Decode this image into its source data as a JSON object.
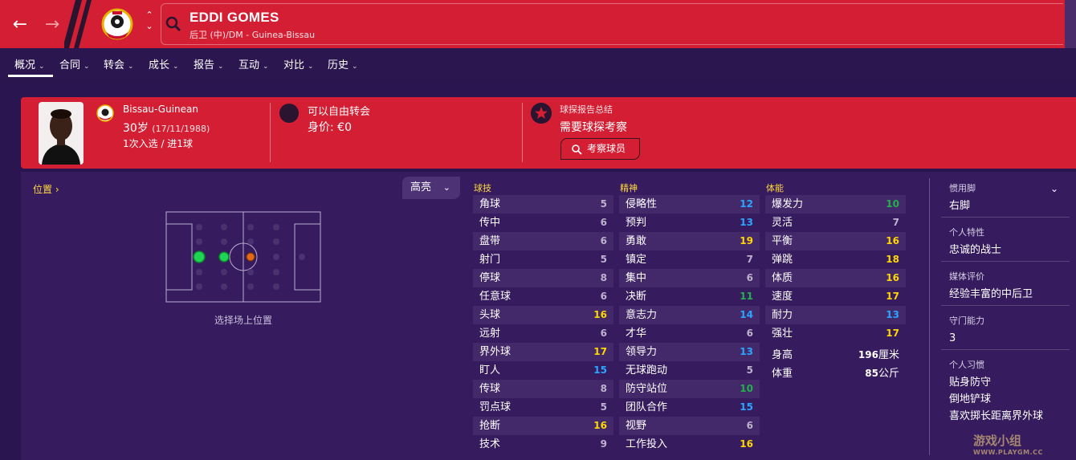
{
  "header": {
    "player_name": "EDDI GOMES",
    "player_subtitle": "后卫 (中)/DM - Guinea-Bissau"
  },
  "tabs": [
    {
      "label": "概况"
    },
    {
      "label": "合同"
    },
    {
      "label": "转会"
    },
    {
      "label": "成长"
    },
    {
      "label": "报告"
    },
    {
      "label": "互动"
    },
    {
      "label": "对比"
    },
    {
      "label": "历史"
    }
  ],
  "summary": {
    "nationality": "Bissau-Guinean",
    "age": "30岁",
    "dob": "(17/11/1988)",
    "caps": "1次入选 / 进1球",
    "transfer_status": "可以自由转会",
    "value": "身价: €0",
    "scout_header": "球探报告总结",
    "scout_need": "需要球探考察",
    "scout_button": "考察球员"
  },
  "position": {
    "label": "位置",
    "highlight_label": "高亮",
    "caption": "选择场上位置"
  },
  "attributes": {
    "technical_title": "球技",
    "mental_title": "精神",
    "physical_title": "体能",
    "technical": [
      {
        "name": "角球",
        "value": "5"
      },
      {
        "name": "传中",
        "value": "6"
      },
      {
        "name": "盘带",
        "value": "6"
      },
      {
        "name": "射门",
        "value": "5"
      },
      {
        "name": "停球",
        "value": "8"
      },
      {
        "name": "任意球",
        "value": "6"
      },
      {
        "name": "头球",
        "value": "16"
      },
      {
        "name": "远射",
        "value": "6"
      },
      {
        "name": "界外球",
        "value": "17"
      },
      {
        "name": "盯人",
        "value": "15"
      },
      {
        "name": "传球",
        "value": "8"
      },
      {
        "name": "罚点球",
        "value": "5"
      },
      {
        "name": "抢断",
        "value": "16"
      },
      {
        "name": "技术",
        "value": "9"
      }
    ],
    "mental": [
      {
        "name": "侵略性",
        "value": "12"
      },
      {
        "name": "预判",
        "value": "13"
      },
      {
        "name": "勇敢",
        "value": "19"
      },
      {
        "name": "镇定",
        "value": "7"
      },
      {
        "name": "集中",
        "value": "6"
      },
      {
        "name": "决断",
        "value": "11"
      },
      {
        "name": "意志力",
        "value": "14"
      },
      {
        "name": "才华",
        "value": "6"
      },
      {
        "name": "领导力",
        "value": "13"
      },
      {
        "name": "无球跑动",
        "value": "5"
      },
      {
        "name": "防守站位",
        "value": "10"
      },
      {
        "name": "团队合作",
        "value": "15"
      },
      {
        "name": "视野",
        "value": "6"
      },
      {
        "name": "工作投入",
        "value": "16"
      }
    ],
    "physical": [
      {
        "name": "爆发力",
        "value": "10"
      },
      {
        "name": "灵活",
        "value": "7"
      },
      {
        "name": "平衡",
        "value": "16"
      },
      {
        "name": "弹跳",
        "value": "18"
      },
      {
        "name": "体质",
        "value": "16"
      },
      {
        "name": "速度",
        "value": "17"
      },
      {
        "name": "耐力",
        "value": "13"
      },
      {
        "name": "强壮",
        "value": "17"
      }
    ],
    "height_label": "身高",
    "height_value": "196",
    "height_unit": "厘米",
    "weight_label": "体重",
    "weight_value": "85",
    "weight_unit": "公斤"
  },
  "side_info": {
    "foot_label": "惯用脚",
    "foot_value": "右脚",
    "trait_label": "个人特性",
    "trait_value": "忠诚的战士",
    "media_label": "媒体评价",
    "media_value": "经验丰富的中后卫",
    "gk_label": "守门能力",
    "gk_value": "3",
    "habits_label": "个人习惯",
    "habits": [
      "贴身防守",
      "倒地铲球",
      "喜欢掷长距离界外球"
    ]
  },
  "watermark": {
    "text": "游戏小组",
    "sub": "WWW.PLAYGM.CC"
  },
  "colors": {
    "header_red": "#d31e33",
    "background_purple": "#2a1550",
    "attr_yellow": "#ffd700",
    "attr_blue": "#2aa6ff",
    "attr_green": "#22b14c"
  }
}
